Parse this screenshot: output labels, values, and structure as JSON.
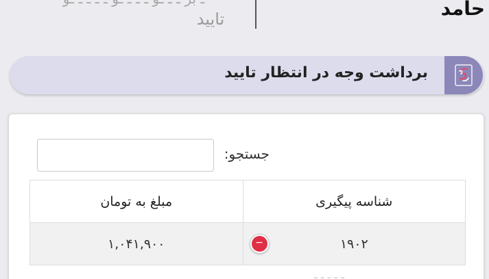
{
  "header": {
    "user_name": "حامد",
    "cut_text": "ـ بر ـ ـ ـو ـ ـ ـ ـو ـ ـ ـ ـ ـو",
    "status_text": "تایید"
  },
  "banner": {
    "title": "برداشت وجه در انتظار تایید",
    "logo_icon": "brand-logo-icon"
  },
  "search": {
    "label": "جستجو:",
    "value": "",
    "placeholder": ""
  },
  "table": {
    "headers": [
      "شناسه پیگیری",
      "مبلغ به تومان"
    ],
    "rows": [
      {
        "id": "۱۹۰۲",
        "amount": "۱,۰۴۱,۹۰۰",
        "toggle_symbol": "−"
      }
    ]
  },
  "footer": {
    "cut_text": "ـ ـ ـ ـ ـ"
  },
  "colors": {
    "accent": "#8b87b8",
    "banner_bg": "#dcdced",
    "toggle": "#e02e47"
  }
}
